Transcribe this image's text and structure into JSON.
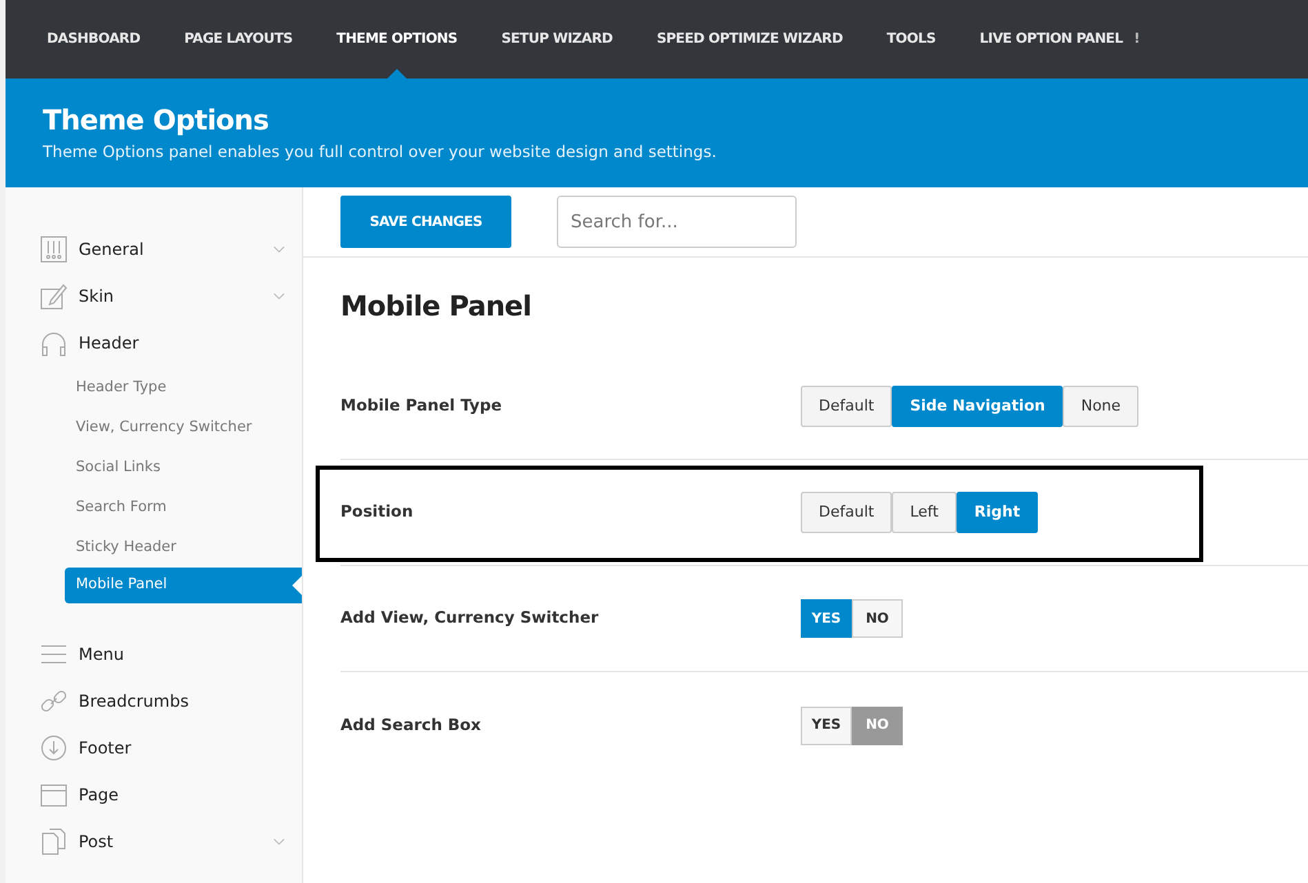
{
  "top_nav": [
    {
      "label": "DASHBOARD",
      "selected": false
    },
    {
      "label": "PAGE LAYOUTS",
      "selected": false
    },
    {
      "label": "THEME OPTIONS",
      "selected": true
    },
    {
      "label": "SETUP WIZARD",
      "selected": false
    },
    {
      "label": "SPEED OPTIMIZE WIZARD",
      "selected": false
    },
    {
      "label": "TOOLS",
      "selected": false
    },
    {
      "label": "LIVE OPTION PANEL",
      "selected": false,
      "badge": "!"
    }
  ],
  "banner": {
    "title": "Theme Options",
    "subtitle": "Theme Options panel enables you full control over your website design and settings."
  },
  "sidebar": {
    "items": [
      {
        "label": "General",
        "expandable": true
      },
      {
        "label": "Skin",
        "expandable": true
      },
      {
        "label": "Header",
        "expandable": false,
        "children": [
          {
            "label": "Header Type",
            "selected": false
          },
          {
            "label": "View, Currency Switcher",
            "selected": false
          },
          {
            "label": "Social Links",
            "selected": false
          },
          {
            "label": "Search Form",
            "selected": false
          },
          {
            "label": "Sticky Header",
            "selected": false
          },
          {
            "label": "Mobile Panel",
            "selected": true
          }
        ]
      },
      {
        "label": "Menu",
        "expandable": false
      },
      {
        "label": "Breadcrumbs",
        "expandable": false
      },
      {
        "label": "Footer",
        "expandable": false
      },
      {
        "label": "Page",
        "expandable": false
      },
      {
        "label": "Post",
        "expandable": true
      }
    ]
  },
  "toolbar": {
    "save_button": "SAVE CHANGES",
    "search": {
      "placeholder": "Search for..."
    }
  },
  "section_title": "Mobile Panel",
  "options": [
    {
      "label": "Mobile Panel Type",
      "kind": "segmented",
      "highlighted": false,
      "choices": [
        {
          "label": "Default",
          "selected": false
        },
        {
          "label": "Side Navigation",
          "selected": true
        },
        {
          "label": "None",
          "selected": false
        }
      ]
    },
    {
      "label": "Position",
      "kind": "segmented",
      "highlighted": true,
      "choices": [
        {
          "label": "Default",
          "selected": false
        },
        {
          "label": "Left",
          "selected": false
        },
        {
          "label": "Right",
          "selected": true
        }
      ]
    },
    {
      "label": "Add View, Currency Switcher",
      "kind": "toggle",
      "highlighted": false,
      "choices": [
        {
          "label": "YES",
          "selected": true
        },
        {
          "label": "NO",
          "selected": false
        }
      ]
    },
    {
      "label": "Add Search Box",
      "kind": "toggle",
      "highlighted": false,
      "choices": [
        {
          "label": "YES",
          "selected": false
        },
        {
          "label": "NO",
          "selected": true
        }
      ]
    }
  ]
}
